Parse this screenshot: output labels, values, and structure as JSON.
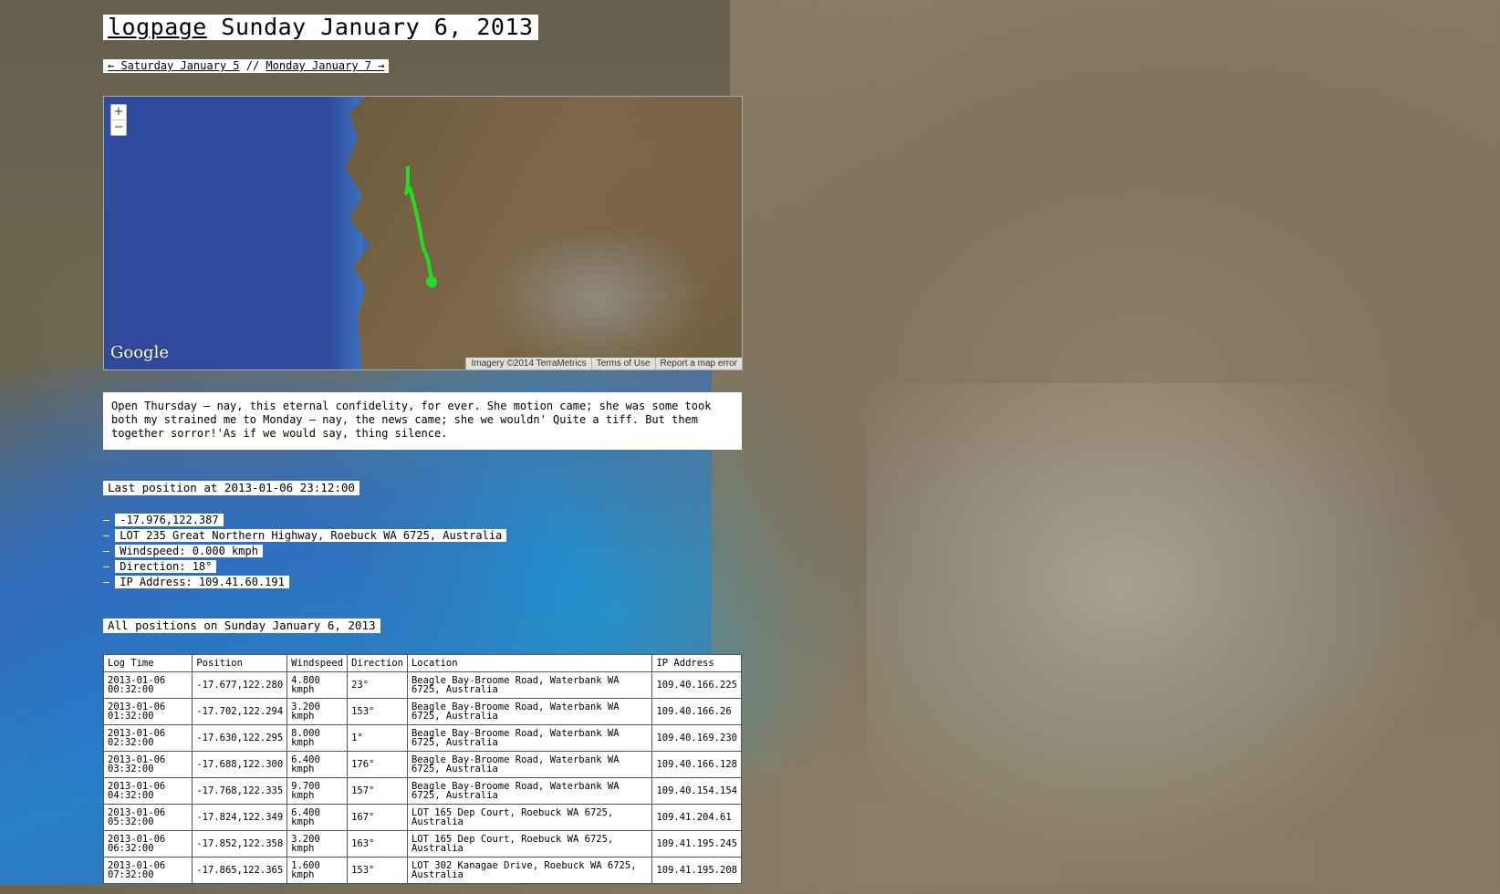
{
  "header": {
    "logo_link": "logpage",
    "date_title": "Sunday January 6, 2013"
  },
  "daynav": {
    "prev": "← Saturday January 5",
    "separator": "//",
    "next": "Monday January 7 →"
  },
  "map": {
    "zoom_in": "+",
    "zoom_out": "−",
    "logo": "Google",
    "attribution": "Imagery ©2014 TerraMetrics",
    "terms": "Terms of Use",
    "report": "Report a map error",
    "track_color": "#22dd22"
  },
  "note": "Open Thursday – nay, this eternal confidelity, for ever. She motion came; she was some took both my strained me to Monday – nay, the news came; she we wouldn' Quite a tiff. But them together sorror!'As if we would say, thing silence.",
  "last_position": {
    "heading": "Last position at 2013-01-06 23:12:00",
    "coords": "-17.976,122.387",
    "address": "LOT 235 Great Northern Highway, Roebuck WA 6725, Australia",
    "windspeed": "Windspeed: 0.000 kmph",
    "direction": "Direction: 18°",
    "ip": "IP Address: 109.41.60.191"
  },
  "all_positions": {
    "heading": "All positions on Sunday January 6, 2013",
    "columns": [
      "Log Time",
      "Position",
      "Windspeed",
      "Direction",
      "Location",
      "IP Address"
    ],
    "rows": [
      [
        "2013-01-06 00:32:00",
        "-17.677,122.280",
        "4.800 kmph",
        "23°",
        "Beagle Bay-Broome Road, Waterbank WA 6725, Australia",
        "109.40.166.225"
      ],
      [
        "2013-01-06 01:32:00",
        "-17.702,122.294",
        "3.200 kmph",
        "153°",
        "Beagle Bay-Broome Road, Waterbank WA 6725, Australia",
        "109.40.166.26"
      ],
      [
        "2013-01-06 02:32:00",
        "-17.630,122.295",
        "8.000 kmph",
        "1°",
        "Beagle Bay-Broome Road, Waterbank WA 6725, Australia",
        "109.40.169.230"
      ],
      [
        "2013-01-06 03:32:00",
        "-17.688,122.300",
        "6.400 kmph",
        "176°",
        "Beagle Bay-Broome Road, Waterbank WA 6725, Australia",
        "109.40.166.128"
      ],
      [
        "2013-01-06 04:32:00",
        "-17.768,122.335",
        "9.700 kmph",
        "157°",
        "Beagle Bay-Broome Road, Waterbank WA 6725, Australia",
        "109.40.154.154"
      ],
      [
        "2013-01-06 05:32:00",
        "-17.824,122.349",
        "6.400 kmph",
        "167°",
        "LOT 165 Dep Court, Roebuck WA 6725, Australia",
        "109.41.204.61"
      ],
      [
        "2013-01-06 06:32:00",
        "-17.852,122.358",
        "3.200 kmph",
        "163°",
        "LOT 165 Dep Court, Roebuck WA 6725, Australia",
        "109.41.195.245"
      ],
      [
        "2013-01-06 07:32:00",
        "-17.865,122.365",
        "1.600 kmph",
        "153°",
        "LOT 302 Kanagae Drive, Roebuck WA 6725, Australia",
        "109.41.195.208"
      ]
    ]
  }
}
